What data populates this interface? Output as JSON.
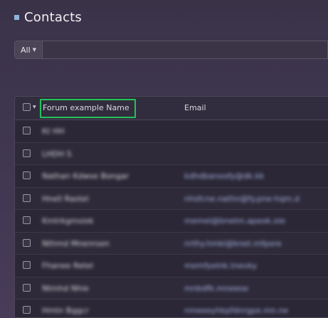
{
  "header": {
    "title": "Contacts"
  },
  "search": {
    "filter_label": "All",
    "value": ""
  },
  "table": {
    "columns": {
      "name": "Forum example Name",
      "email": "Email"
    },
    "rows": [
      {
        "name": "Kt HH",
        "email": ""
      },
      {
        "name": "LHDH S",
        "email": ""
      },
      {
        "name": "Nathan Kdwse Bongar",
        "email": "kdhdbanoofy@dk.kk"
      },
      {
        "name": "Hnell Rastel",
        "email": "nhsfcne.nathn@fy.pne-hqm.d"
      },
      {
        "name": "Kmtrkgmsiok",
        "email": "memel@bnetm.apeok.oie"
      },
      {
        "name": "Nthmd Mnenrsen",
        "email": "nrthy.hmkl@knet.mfpore"
      },
      {
        "name": "Fhanee Retel",
        "email": "memfyelnk.tnevky"
      },
      {
        "name": "Ntmhd Nhie",
        "email": "mnbdfk.mneeoe"
      },
      {
        "name": "Hmtn Bggcr",
        "email": "nmeeeyhkpfdnrgpe.mn.ne"
      }
    ]
  }
}
